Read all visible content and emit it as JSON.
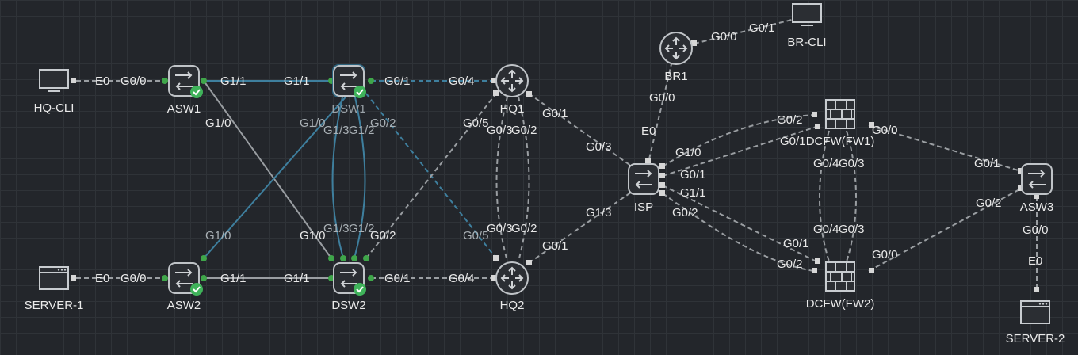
{
  "topology": {
    "nodes": [
      {
        "id": "hq-cli",
        "label": "HQ-CLI",
        "type": "pc"
      },
      {
        "id": "asw1",
        "label": "ASW1",
        "type": "switch",
        "status": "ok"
      },
      {
        "id": "dsw1",
        "label": "DSW1",
        "type": "switch",
        "status": "ok",
        "selected": true
      },
      {
        "id": "hq1",
        "label": "HQ1",
        "type": "router"
      },
      {
        "id": "br1",
        "label": "BR1",
        "type": "router"
      },
      {
        "id": "br-cli",
        "label": "BR-CLI",
        "type": "pc"
      },
      {
        "id": "isp",
        "label": "ISP",
        "type": "switch"
      },
      {
        "id": "fw1",
        "label": "DCFW(FW1)",
        "type": "firewall"
      },
      {
        "id": "fw2",
        "label": "DCFW(FW2)",
        "type": "firewall"
      },
      {
        "id": "asw3",
        "label": "ASW3",
        "type": "switch"
      },
      {
        "id": "server-1",
        "label": "SERVER-1",
        "type": "server"
      },
      {
        "id": "asw2",
        "label": "ASW2",
        "type": "switch",
        "status": "ok"
      },
      {
        "id": "dsw2",
        "label": "DSW2",
        "type": "switch",
        "status": "ok"
      },
      {
        "id": "hq2",
        "label": "HQ2",
        "type": "router"
      },
      {
        "id": "server-2",
        "label": "SERVER-2",
        "type": "server"
      }
    ],
    "ports": [
      "E0",
      "G0/0",
      "G1/1",
      "G1/1",
      "G0/1",
      "G0/4",
      "G1/0",
      "G1/0",
      "G1/3",
      "G1/2",
      "G0/2",
      "G0/5",
      "G0/3",
      "G0/2",
      "G0/1",
      "G0/0",
      "G0/0",
      "G0/1",
      "E0",
      "G0/3",
      "G1/0",
      "G0/1",
      "G1/1",
      "G0/2",
      "G0/2",
      "G0/1",
      "G0/0",
      "G0/4",
      "G0/3",
      "G0/1",
      "G0/2",
      "G0/4",
      "G0/3",
      "G0/1",
      "G0/2",
      "G0/0",
      "G0/0",
      "E0",
      "G1/0",
      "G1/0",
      "G1/3",
      "G1/2",
      "G0/2",
      "G0/5",
      "G0/3",
      "G0/2",
      "G1/3",
      "G0/1",
      "E0",
      "G0/0",
      "G1/1",
      "G1/1",
      "G0/1",
      "G0/4"
    ],
    "colors": {
      "link": "#9a9ea2",
      "selected_link": "#3e7f9e",
      "ok": "#3fb35a",
      "port": "#3fa64a",
      "port_box": "#d6d6d6",
      "icon_stroke": "#bfc3c7"
    }
  }
}
